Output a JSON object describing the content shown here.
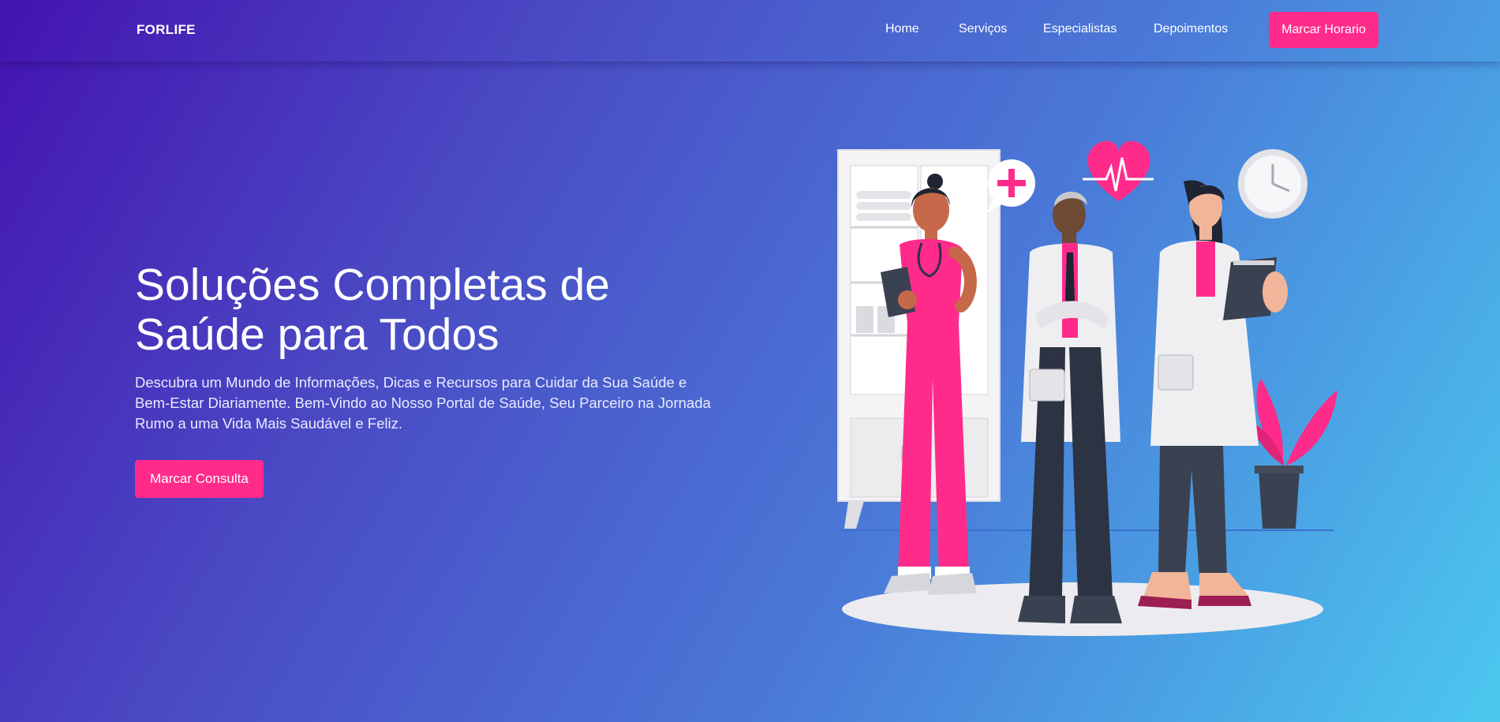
{
  "nav": {
    "brand": "FORLIFE",
    "links": [
      {
        "label": "Home"
      },
      {
        "label": "Serviços"
      },
      {
        "label": "Especialistas"
      },
      {
        "label": "Depoimentos"
      }
    ],
    "cta_label": "Marcar Horario"
  },
  "hero": {
    "title_line1": "Soluções Completas de",
    "title_line2": "Saúde para Todos",
    "description": "Descubra um Mundo de Informações, Dicas e Recursos para Cuidar da Sua Saúde e Bem-Estar Diariamente. Bem-Vindo ao Nosso Portal de Saúde, Seu Parceiro na Jornada Rumo a uma Vida Mais Saudável e Feliz.",
    "cta_label": "Marcar Consulta"
  },
  "illustration": {
    "icons": [
      "medical-cabinet-icon",
      "plus-speech-bubble-icon",
      "heartbeat-icon",
      "clock-icon",
      "plant-icon"
    ]
  },
  "colors": {
    "accent": "#ff2b8a",
    "gradient_start": "#4413b0",
    "gradient_end": "#4bc8ef"
  }
}
